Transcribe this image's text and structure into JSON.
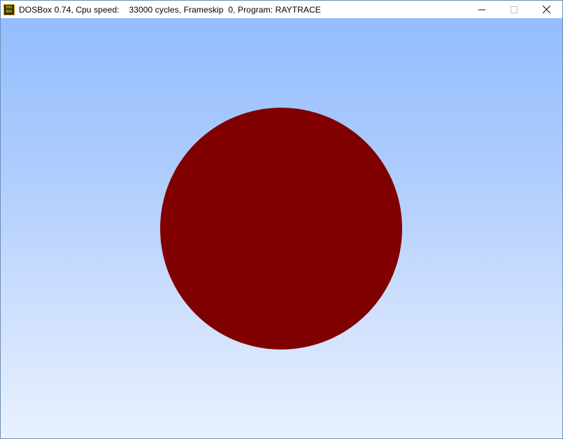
{
  "window": {
    "title": "DOSBox 0.74, Cpu speed:    33000 cycles, Frameskip  0, Program: RAYTRACE",
    "icon": "dosbox-icon",
    "icon_text_top": "DOS",
    "icon_text_bottom": "BOX",
    "controls": [
      "minimize-icon",
      "maximize-icon",
      "close-icon"
    ]
  },
  "scene": {
    "sky_top_color": "#93bdfd",
    "sky_bottom_color": "#e8f1ff",
    "sphere_color": "#800000"
  }
}
